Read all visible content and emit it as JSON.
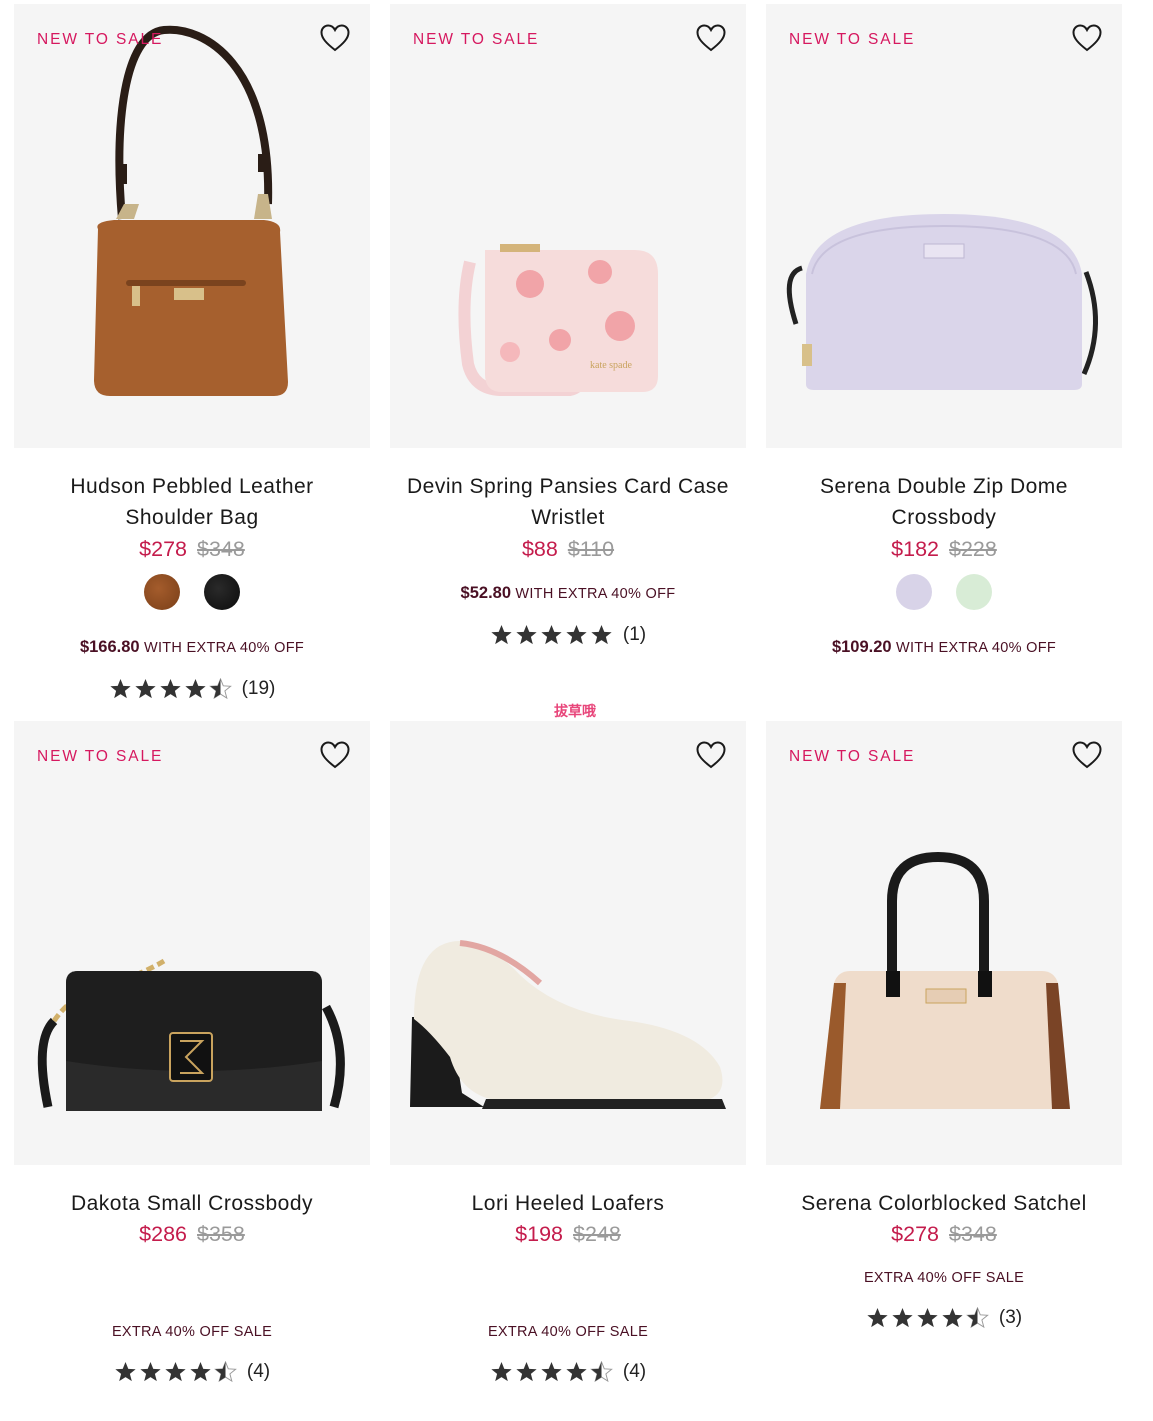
{
  "badge_text": "NEW TO SALE",
  "watermark": "拔草哦",
  "products": [
    {
      "name_line1": "Hudson Pebbled Leather",
      "name_line2": "Shoulder Bag",
      "sale_price": "$278",
      "original_price": "$348",
      "promo_price": "$166.80",
      "promo_text": "WITH EXTRA 40% OFF",
      "rating_count": "(19)",
      "rating": 4.5,
      "swatch_colors": [
        "#8a4a22",
        "#151515"
      ]
    },
    {
      "name_line1": "Devin Spring Pansies Card Case",
      "name_line2": "Wristlet",
      "sale_price": "$88",
      "original_price": "$110",
      "promo_price": "$52.80",
      "promo_text": "WITH EXTRA 40% OFF",
      "rating_count": "(1)",
      "rating": 5
    },
    {
      "name_line1": "Serena Double Zip Dome",
      "name_line2": "Crossbody",
      "sale_price": "$182",
      "original_price": "$228",
      "promo_price": "$109.20",
      "promo_text": "WITH EXTRA 40% OFF",
      "swatch_colors": [
        "#d8d3e8",
        "#d8ecd6"
      ]
    },
    {
      "name_line1": "Dakota Small Crossbody",
      "sale_price": "$286",
      "original_price": "$358",
      "promo_text": "EXTRA 40% OFF SALE",
      "rating_count": "(4)",
      "rating": 4.5
    },
    {
      "name_line1": "Lori Heeled Loafers",
      "sale_price": "$198",
      "original_price": "$248",
      "promo_text": "EXTRA 40% OFF SALE",
      "rating_count": "(4)",
      "rating": 4.5
    },
    {
      "name_line1": "Serena Colorblocked Satchel",
      "sale_price": "$278",
      "original_price": "$348",
      "promo_text": "EXTRA 40% OFF SALE",
      "rating_count": "(3)",
      "rating": 4.5
    }
  ],
  "colors": {
    "badge": "#d6185f",
    "sale_price": "#c41c4c",
    "original_price": "#9a9a9a",
    "promo": "#4a1024",
    "image_bg": "#f5f5f5"
  },
  "icons": {
    "wishlist": "heart-outline-icon",
    "rating_full": "star-icon",
    "rating_half": "half-star-icon"
  }
}
